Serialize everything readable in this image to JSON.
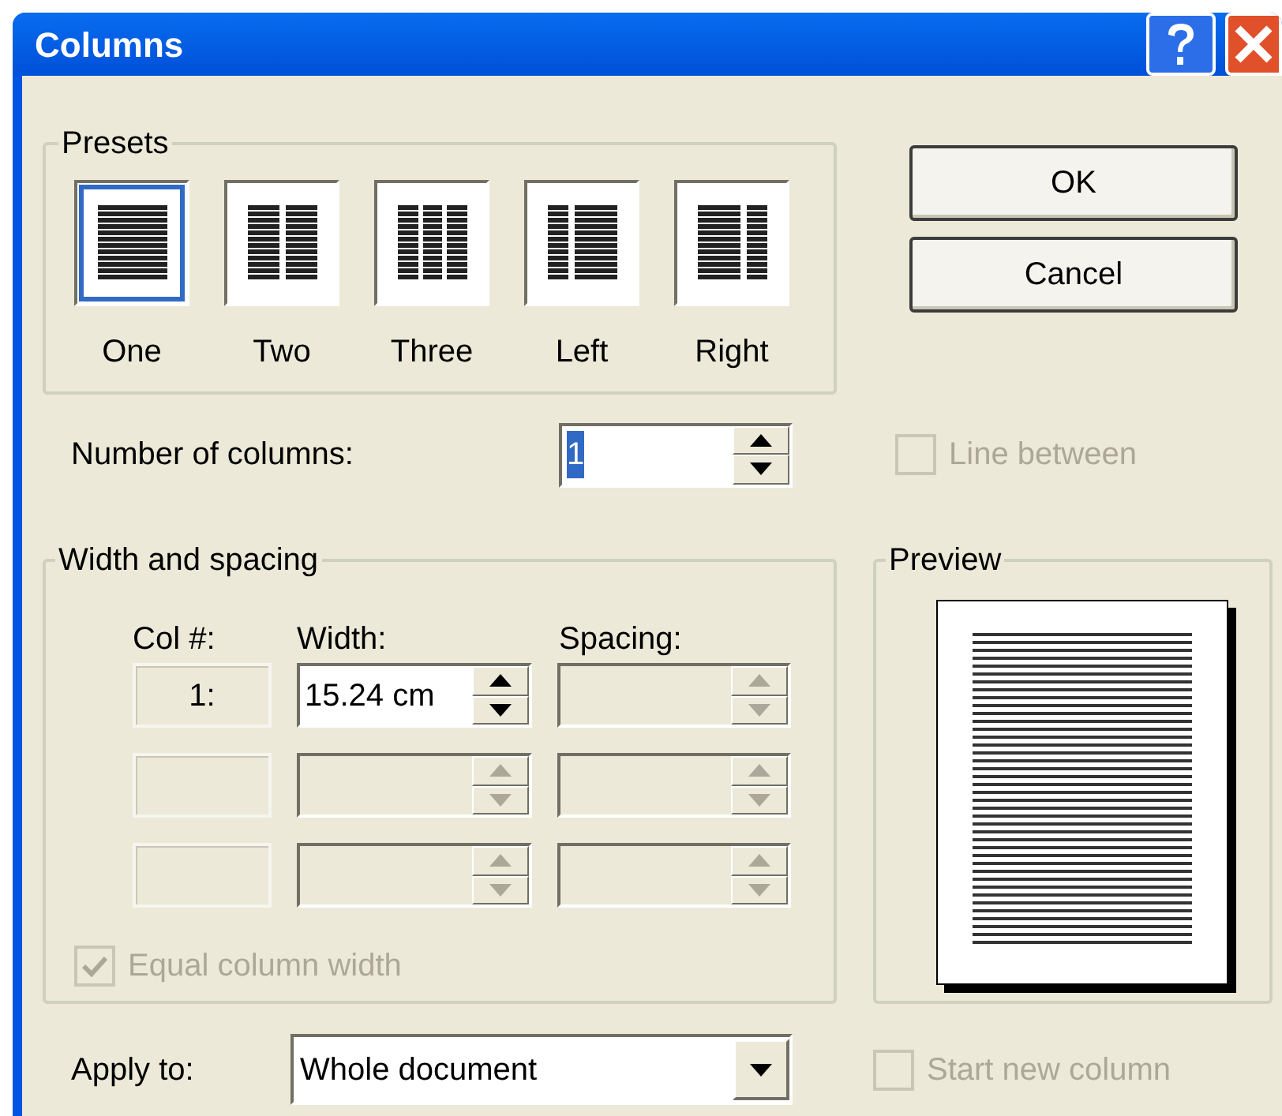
{
  "window": {
    "title": "Columns"
  },
  "presets": {
    "label": "Presets",
    "items": [
      {
        "label": "One",
        "kind": "one",
        "selected": true
      },
      {
        "label": "Two",
        "kind": "two",
        "selected": false
      },
      {
        "label": "Three",
        "kind": "three",
        "selected": false
      },
      {
        "label": "Left",
        "kind": "left",
        "selected": false
      },
      {
        "label": "Right",
        "kind": "right",
        "selected": false
      }
    ]
  },
  "buttons": [
    {
      "label": "OK"
    },
    {
      "label": "Cancel"
    }
  ],
  "number_of_columns": {
    "label": "Number of columns:",
    "value": "1",
    "value_selected": true
  },
  "line_between": {
    "label": "Line between",
    "checked": false,
    "disabled": true
  },
  "width_and_spacing": {
    "label": "Width and spacing",
    "columns": [
      {
        "label": "Col #:"
      },
      {
        "label": "Width:"
      },
      {
        "label": "Spacing:"
      }
    ],
    "rows": [
      {
        "col": "1:",
        "width": "15.24 cm",
        "width_disabled": false,
        "spacing_disabled": true
      },
      {
        "width_disabled": true,
        "spacing_disabled": true
      },
      {
        "width_disabled": true,
        "spacing_disabled": true
      }
    ],
    "equal_column_width": {
      "label": "Equal column width",
      "checked": true,
      "disabled": true
    }
  },
  "preview": {
    "label": "Preview"
  },
  "apply_to": {
    "label": "Apply to:",
    "value": "Whole document"
  },
  "start_new_column": {
    "label": "Start new column",
    "checked": false,
    "disabled": true
  }
}
